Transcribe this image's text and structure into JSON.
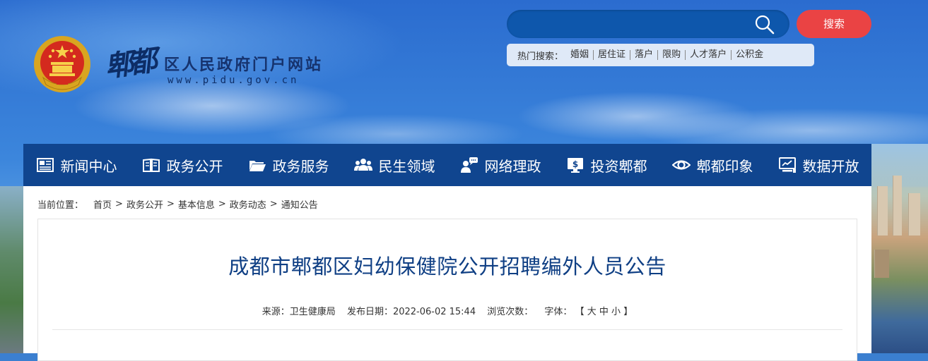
{
  "header": {
    "logo_script": "郫都",
    "site_name": "区人民政府门户网站",
    "site_url": "www.pidu.gov.cn"
  },
  "search": {
    "placeholder": "",
    "button_label": "搜索",
    "hot_label": "热门搜索：",
    "hot_items": [
      "婚姻",
      "居住证",
      "落户",
      "限购",
      "人才落户",
      "公积金"
    ]
  },
  "nav": {
    "items": [
      {
        "label": "新闻中心",
        "icon": "newspaper-icon"
      },
      {
        "label": "政务公开",
        "icon": "open-book-icon"
      },
      {
        "label": "政务服务",
        "icon": "folder-icon"
      },
      {
        "label": "民生领域",
        "icon": "people-group-icon"
      },
      {
        "label": "网络理政",
        "icon": "user-chat-icon"
      },
      {
        "label": "投资郫都",
        "icon": "dollar-screen-icon"
      },
      {
        "label": "郫都印象",
        "icon": "eye-icon"
      },
      {
        "label": "数据开放",
        "icon": "monitor-chart-icon"
      }
    ]
  },
  "breadcrumb": {
    "prefix": "当前位置：",
    "items": [
      "首页",
      "政务公开",
      "基本信息",
      "政务动态",
      "通知公告"
    ],
    "separator": ">"
  },
  "article": {
    "title": "成都市郫都区妇幼保健院公开招聘编外人员公告",
    "source": "来源：卫生健康局",
    "date": "发布日期：2022-06-02 15:44",
    "views": "浏览次数：",
    "font_label": "字体：",
    "font_open": "【",
    "font_large": "大",
    "font_medium": "中",
    "font_small": "小",
    "font_close": "】"
  },
  "colors": {
    "nav_bg": "#10458f",
    "search_bg": "#0e57ac",
    "search_button": "#ea4344",
    "title": "#0f3f84"
  }
}
